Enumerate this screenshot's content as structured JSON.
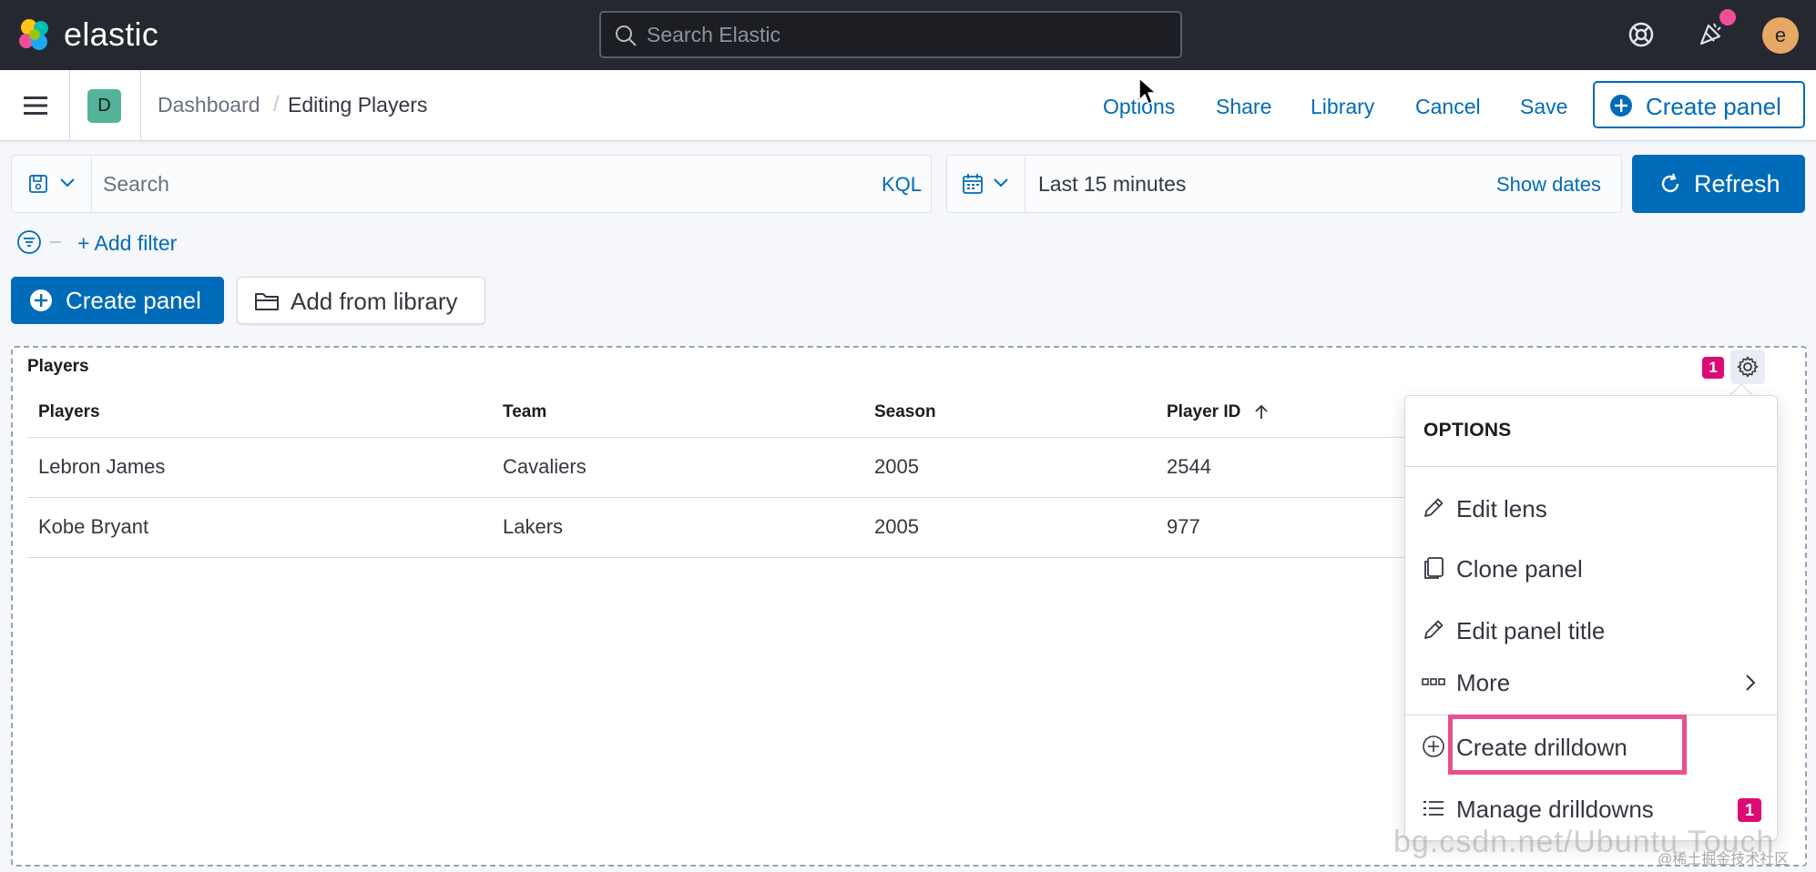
{
  "header": {
    "brand": "elastic",
    "search_placeholder": "Search Elastic",
    "avatar_initial": "e",
    "colors": {
      "background": "#25282f",
      "notification": "#f04e98",
      "avatar": "#e7a866"
    }
  },
  "appbar": {
    "space_initial": "D",
    "breadcrumbs": [
      "Dashboard",
      "Editing Players"
    ],
    "breadcrumb_separator": "/",
    "links": {
      "options": "Options",
      "share": "Share",
      "library": "Library",
      "cancel": "Cancel",
      "save": "Save"
    },
    "create_panel": "Create panel"
  },
  "query": {
    "search_placeholder": "Search",
    "language": "KQL",
    "date_range": "Last 15 minutes",
    "show_dates": "Show dates",
    "refresh": "Refresh"
  },
  "filters": {
    "add_filter": "+ Add filter"
  },
  "toolbar": {
    "create_panel": "Create panel",
    "add_from_library": "Add from library"
  },
  "panel": {
    "title": "Players",
    "badge_count": "1",
    "table": {
      "headers": [
        "Players",
        "Team",
        "Season",
        "Player ID"
      ],
      "sorted_column": "Player ID",
      "sort_direction": "ascending",
      "rows": [
        [
          "Lebron James",
          "Cavaliers",
          "2005",
          "2544"
        ],
        [
          "Kobe Bryant",
          "Lakers",
          "2005",
          "977"
        ]
      ]
    }
  },
  "context_menu": {
    "title": "OPTIONS",
    "items": {
      "edit_lens": "Edit lens",
      "clone_panel": "Clone panel",
      "edit_panel_title": "Edit panel title",
      "more": "More",
      "create_drilldown": "Create drilldown",
      "manage_drilldowns": "Manage drilldowns"
    },
    "manage_drilldowns_badge": "1",
    "highlight_color": "#e8508f"
  },
  "watermark": {
    "main": "bg.csdn.net/Ubuntu Touch",
    "sub": "@稀土掘金技术社区"
  },
  "colors": {
    "primary": "#006bb8",
    "accent": "#dd0a73",
    "space": "#54b399"
  }
}
